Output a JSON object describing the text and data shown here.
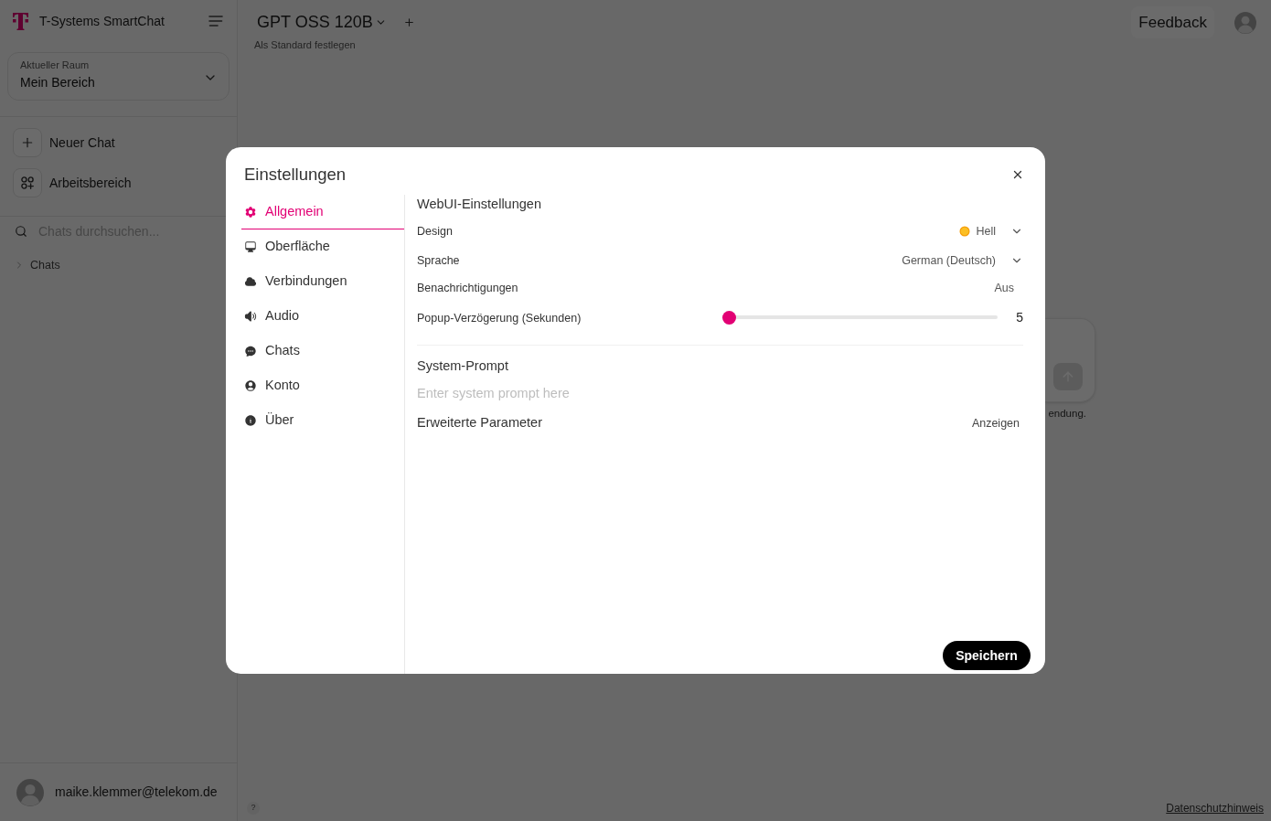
{
  "sidebar": {
    "brand": "T-Systems SmartChat",
    "room": {
      "label": "Aktueller Raum",
      "value": "Mein Bereich"
    },
    "actions": [
      {
        "label": "Neuer Chat"
      },
      {
        "label": "Arbeitsbereich"
      }
    ],
    "search": {
      "placeholder": "Chats durchsuchen..."
    },
    "folders": [
      {
        "label": "Chats",
        "expanded": false
      }
    ],
    "user": {
      "email": "maike.klemmer@telekom.de"
    }
  },
  "header": {
    "model": "GPT OSS 120B",
    "set_default": "Als Standard festlegen",
    "feedback": "Feedback"
  },
  "chat_input": {
    "hint": "endung."
  },
  "footer": {
    "help": "?",
    "privacy_link": "Datenschutzhinweis"
  },
  "dialog": {
    "title": "Einstellungen",
    "tabs": [
      {
        "label": "Allgemein",
        "selected": true
      },
      {
        "label": "Oberfläche",
        "selected": false
      },
      {
        "label": "Verbindungen",
        "selected": false
      },
      {
        "label": "Audio",
        "selected": false
      },
      {
        "label": "Chats",
        "selected": false
      },
      {
        "label": "Konto",
        "selected": false
      },
      {
        "label": "Über",
        "selected": false
      }
    ],
    "section_title": "WebUI-Einstellungen",
    "settings": [
      {
        "kind": "theme",
        "label": "Design",
        "value": "Hell"
      },
      {
        "kind": "select",
        "label": "Sprache",
        "value": "German (Deutsch)"
      },
      {
        "kind": "button",
        "label": "Benachrichtigungen",
        "value": "Aus"
      },
      {
        "kind": "slider",
        "label": "Popup-Verzögerung (Sekunden)",
        "level": 0,
        "reading": "5"
      }
    ],
    "system_prompt": {
      "title": "System-Prompt",
      "placeholder": "Enter system prompt here"
    },
    "advanced": {
      "label": "Erweiterte Parameter",
      "action": "Anzeigen"
    },
    "save": "Speichern"
  }
}
